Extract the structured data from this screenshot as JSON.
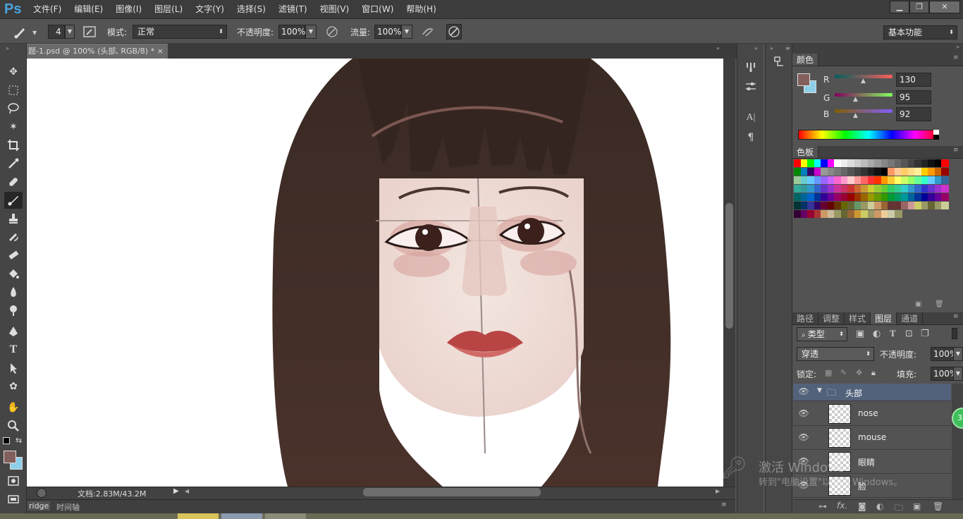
{
  "app": {
    "logo": "Ps"
  },
  "menu": [
    "文件(F)",
    "编辑(E)",
    "图像(I)",
    "图层(L)",
    "文字(Y)",
    "选择(S)",
    "滤镜(T)",
    "视图(V)",
    "窗口(W)",
    "帮助(H)"
  ],
  "window_controls": {
    "minimize": "▁",
    "restore": "❐",
    "close": "✕"
  },
  "options": {
    "brush_size": "4",
    "mode_label": "模式:",
    "mode_value": "正常",
    "opacity_label": "不透明度:",
    "opacity_value": "100%",
    "flow_label": "流量:",
    "flow_value": "100%",
    "workspace": "基本功能"
  },
  "document": {
    "tab_title": "题-1.psd @ 100% (头部, RGB/8) *",
    "close": "×",
    "status": "文档:2.83M/43.2M"
  },
  "bottom": {
    "left_label": "ridge",
    "timeline": "时间轴"
  },
  "color_panel": {
    "tab": "颜色",
    "r_label": "R",
    "g_label": "G",
    "b_label": "B",
    "r": "130",
    "g": "95",
    "b": "92",
    "fg": "#825f5c",
    "bg": "#8ecfe8"
  },
  "swatches_panel": {
    "tab": "色板"
  },
  "layers_panel": {
    "tabs": [
      "路径",
      "调整",
      "样式",
      "图层",
      "通道"
    ],
    "active_tab": "图层",
    "filter": "类型",
    "blend": "穿透",
    "opacity_label": "不透明度:",
    "opacity": "100%",
    "lock_label": "锁定:",
    "fill_label": "填充:",
    "fill": "100%",
    "group": "头部",
    "layers": [
      "nose",
      "mouse",
      "眼睛",
      "脸"
    ]
  },
  "watermark": {
    "line1": "激活 Windows",
    "line2": "转到\"电脑设置\"以激活 Windows。"
  },
  "badge": "38"
}
